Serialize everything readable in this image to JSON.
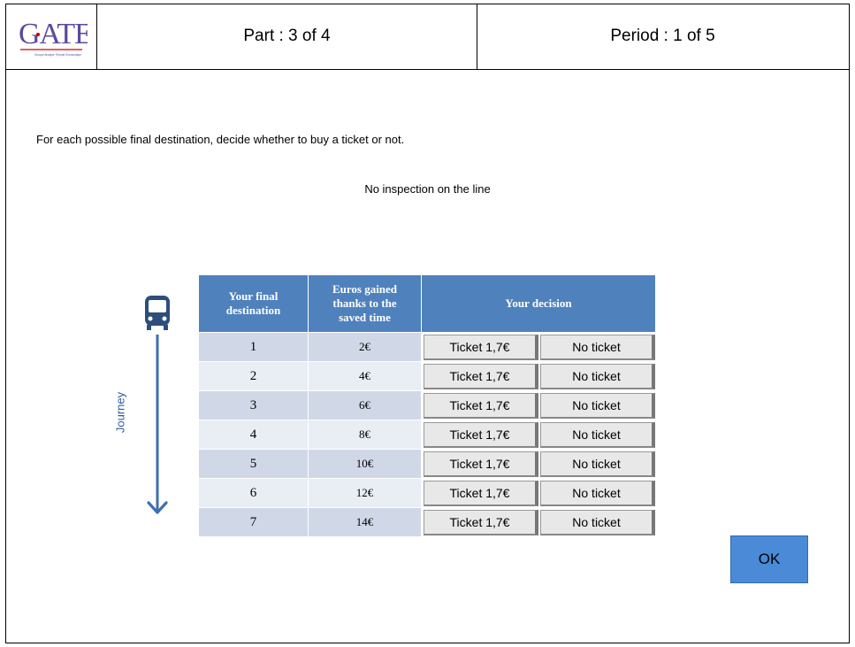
{
  "header": {
    "logo_text": "GATE",
    "logo_subtext": "Groupe Analyse Théorie Économique",
    "part": "Part : 3 of 4",
    "period": "Period : 1 of 5"
  },
  "instruction": "For each possible final destination, decide whether to buy a ticket or not.",
  "inspection": "No inspection on the line",
  "journey_label": "Journey",
  "table": {
    "headers": {
      "destination": [
        "Your final",
        "destination"
      ],
      "euros": [
        "Euros gained",
        "thanks to the",
        "saved time"
      ],
      "decision": "Your decision"
    },
    "rows": [
      {
        "destination": "1",
        "euros": "2€",
        "ticket": "Ticket 1,7€",
        "no_ticket": "No ticket"
      },
      {
        "destination": "2",
        "euros": "4€",
        "ticket": "Ticket 1,7€",
        "no_ticket": "No ticket"
      },
      {
        "destination": "3",
        "euros": "6€",
        "ticket": "Ticket 1,7€",
        "no_ticket": "No ticket"
      },
      {
        "destination": "4",
        "euros": "8€",
        "ticket": "Ticket 1,7€",
        "no_ticket": "No ticket"
      },
      {
        "destination": "5",
        "euros": "10€",
        "ticket": "Ticket 1,7€",
        "no_ticket": "No ticket"
      },
      {
        "destination": "6",
        "euros": "12€",
        "ticket": "Ticket 1,7€",
        "no_ticket": "No ticket"
      },
      {
        "destination": "7",
        "euros": "14€",
        "ticket": "Ticket 1,7€",
        "no_ticket": "No ticket"
      }
    ]
  },
  "ok_label": "OK",
  "colors": {
    "header_blue": "#4f81bd",
    "row_dark": "#d0d8e8",
    "row_light": "#e9edf4",
    "ok_button": "#4a8ad6",
    "journey_arrow": "#3e6fb0",
    "logo_purple": "#5b4a9e"
  },
  "icons": {
    "bus": "bus-icon",
    "arrow": "arrow-down-icon"
  }
}
